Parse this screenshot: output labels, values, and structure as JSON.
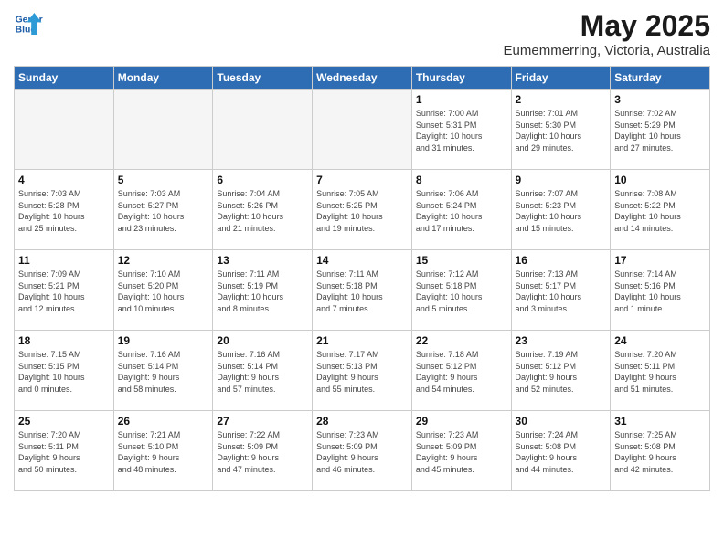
{
  "header": {
    "logo_line1": "General",
    "logo_line2": "Blue",
    "month_title": "May 2025",
    "location": "Eumemmerring, Victoria, Australia"
  },
  "days_of_week": [
    "Sunday",
    "Monday",
    "Tuesday",
    "Wednesday",
    "Thursday",
    "Friday",
    "Saturday"
  ],
  "weeks": [
    [
      {
        "day": "",
        "info": ""
      },
      {
        "day": "",
        "info": ""
      },
      {
        "day": "",
        "info": ""
      },
      {
        "day": "",
        "info": ""
      },
      {
        "day": "1",
        "info": "Sunrise: 7:00 AM\nSunset: 5:31 PM\nDaylight: 10 hours\nand 31 minutes."
      },
      {
        "day": "2",
        "info": "Sunrise: 7:01 AM\nSunset: 5:30 PM\nDaylight: 10 hours\nand 29 minutes."
      },
      {
        "day": "3",
        "info": "Sunrise: 7:02 AM\nSunset: 5:29 PM\nDaylight: 10 hours\nand 27 minutes."
      }
    ],
    [
      {
        "day": "4",
        "info": "Sunrise: 7:03 AM\nSunset: 5:28 PM\nDaylight: 10 hours\nand 25 minutes."
      },
      {
        "day": "5",
        "info": "Sunrise: 7:03 AM\nSunset: 5:27 PM\nDaylight: 10 hours\nand 23 minutes."
      },
      {
        "day": "6",
        "info": "Sunrise: 7:04 AM\nSunset: 5:26 PM\nDaylight: 10 hours\nand 21 minutes."
      },
      {
        "day": "7",
        "info": "Sunrise: 7:05 AM\nSunset: 5:25 PM\nDaylight: 10 hours\nand 19 minutes."
      },
      {
        "day": "8",
        "info": "Sunrise: 7:06 AM\nSunset: 5:24 PM\nDaylight: 10 hours\nand 17 minutes."
      },
      {
        "day": "9",
        "info": "Sunrise: 7:07 AM\nSunset: 5:23 PM\nDaylight: 10 hours\nand 15 minutes."
      },
      {
        "day": "10",
        "info": "Sunrise: 7:08 AM\nSunset: 5:22 PM\nDaylight: 10 hours\nand 14 minutes."
      }
    ],
    [
      {
        "day": "11",
        "info": "Sunrise: 7:09 AM\nSunset: 5:21 PM\nDaylight: 10 hours\nand 12 minutes."
      },
      {
        "day": "12",
        "info": "Sunrise: 7:10 AM\nSunset: 5:20 PM\nDaylight: 10 hours\nand 10 minutes."
      },
      {
        "day": "13",
        "info": "Sunrise: 7:11 AM\nSunset: 5:19 PM\nDaylight: 10 hours\nand 8 minutes."
      },
      {
        "day": "14",
        "info": "Sunrise: 7:11 AM\nSunset: 5:18 PM\nDaylight: 10 hours\nand 7 minutes."
      },
      {
        "day": "15",
        "info": "Sunrise: 7:12 AM\nSunset: 5:18 PM\nDaylight: 10 hours\nand 5 minutes."
      },
      {
        "day": "16",
        "info": "Sunrise: 7:13 AM\nSunset: 5:17 PM\nDaylight: 10 hours\nand 3 minutes."
      },
      {
        "day": "17",
        "info": "Sunrise: 7:14 AM\nSunset: 5:16 PM\nDaylight: 10 hours\nand 1 minute."
      }
    ],
    [
      {
        "day": "18",
        "info": "Sunrise: 7:15 AM\nSunset: 5:15 PM\nDaylight: 10 hours\nand 0 minutes."
      },
      {
        "day": "19",
        "info": "Sunrise: 7:16 AM\nSunset: 5:14 PM\nDaylight: 9 hours\nand 58 minutes."
      },
      {
        "day": "20",
        "info": "Sunrise: 7:16 AM\nSunset: 5:14 PM\nDaylight: 9 hours\nand 57 minutes."
      },
      {
        "day": "21",
        "info": "Sunrise: 7:17 AM\nSunset: 5:13 PM\nDaylight: 9 hours\nand 55 minutes."
      },
      {
        "day": "22",
        "info": "Sunrise: 7:18 AM\nSunset: 5:12 PM\nDaylight: 9 hours\nand 54 minutes."
      },
      {
        "day": "23",
        "info": "Sunrise: 7:19 AM\nSunset: 5:12 PM\nDaylight: 9 hours\nand 52 minutes."
      },
      {
        "day": "24",
        "info": "Sunrise: 7:20 AM\nSunset: 5:11 PM\nDaylight: 9 hours\nand 51 minutes."
      }
    ],
    [
      {
        "day": "25",
        "info": "Sunrise: 7:20 AM\nSunset: 5:11 PM\nDaylight: 9 hours\nand 50 minutes."
      },
      {
        "day": "26",
        "info": "Sunrise: 7:21 AM\nSunset: 5:10 PM\nDaylight: 9 hours\nand 48 minutes."
      },
      {
        "day": "27",
        "info": "Sunrise: 7:22 AM\nSunset: 5:09 PM\nDaylight: 9 hours\nand 47 minutes."
      },
      {
        "day": "28",
        "info": "Sunrise: 7:23 AM\nSunset: 5:09 PM\nDaylight: 9 hours\nand 46 minutes."
      },
      {
        "day": "29",
        "info": "Sunrise: 7:23 AM\nSunset: 5:09 PM\nDaylight: 9 hours\nand 45 minutes."
      },
      {
        "day": "30",
        "info": "Sunrise: 7:24 AM\nSunset: 5:08 PM\nDaylight: 9 hours\nand 44 minutes."
      },
      {
        "day": "31",
        "info": "Sunrise: 7:25 AM\nSunset: 5:08 PM\nDaylight: 9 hours\nand 42 minutes."
      }
    ]
  ]
}
